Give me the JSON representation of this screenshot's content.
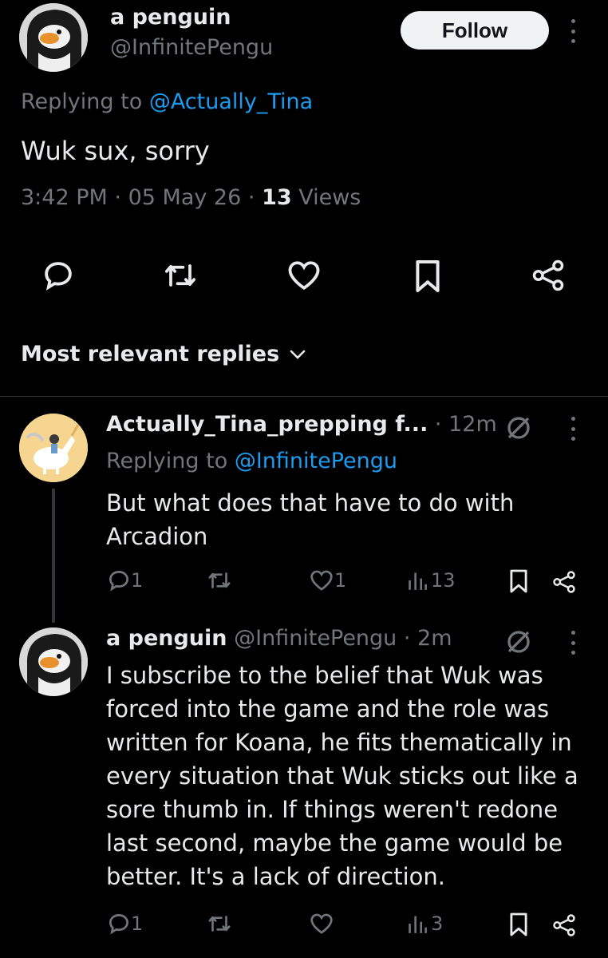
{
  "main_post": {
    "author_name": "a penguin",
    "handle": "@InfinitePengu",
    "follow_label": "Follow",
    "replying_prefix": "Replying to",
    "replying_to": "@Actually_Tina",
    "text": "Wuk sux, sorry",
    "time": "3:42 PM",
    "sep1": "·",
    "date": "05 May 26",
    "sep2": "·",
    "views_count": "13",
    "views_label": "Views"
  },
  "replies_header": {
    "label": "Most relevant replies"
  },
  "reply1": {
    "author_name": "Actually_Tina_prepping f...",
    "time": "· 12m",
    "replying_prefix": "Replying to",
    "replying_to": "@InfinitePengu",
    "text_line1": "But what does that have to do with",
    "text_line2": "Arcadion",
    "replies": "1",
    "likes": "1",
    "views": "13"
  },
  "reply2": {
    "author_name": "a penguin",
    "handle": "@InfinitePengu",
    "time": "· 2m",
    "lines": [
      "I subscribe to the belief that Wuk was",
      "forced into the game and the role was",
      "written for Koana, he fits thematically in",
      "every situation that Wuk sticks out like a",
      "sore thumb in. If things weren't redone",
      "last second, maybe the game would be",
      "better. It's a lack of direction."
    ],
    "replies": "1",
    "views": "3"
  },
  "colors": {
    "background": "#000000",
    "text": "#e7e9ea",
    "muted": "#71767b",
    "link": "#1d9bf0",
    "follow_bg": "#eff3f4"
  }
}
